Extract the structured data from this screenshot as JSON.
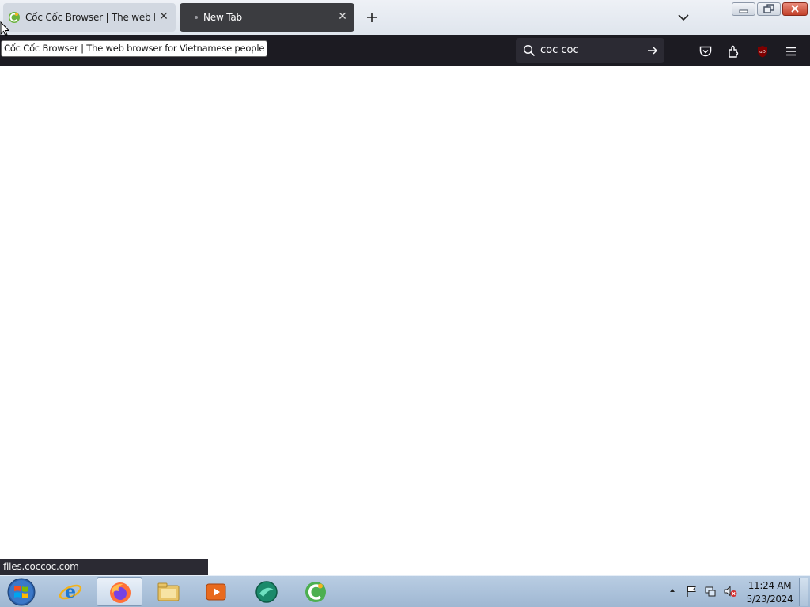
{
  "tabs": [
    {
      "title": "Cốc Cốc Browser | The web browser for Vietnamese people",
      "active": false,
      "favicon": "coccoc-icon"
    },
    {
      "title": "New Tab",
      "active": true,
      "favicon": "dot-icon"
    }
  ],
  "tooltip": "Cốc Cốc Browser | The web browser for Vietnamese people",
  "search": {
    "value": "coc coc"
  },
  "status_url": "files.coccoc.com",
  "clock": {
    "time": "11:24 AM",
    "date": "5/23/2024"
  },
  "taskbar": {
    "apps": [
      "internet-explorer-icon",
      "firefox-icon",
      "windows-explorer-icon",
      "media-player-icon",
      "app-icon",
      "coccoc-icon"
    ],
    "active": "firefox-icon"
  },
  "colors": {
    "navbar": "#1c1b22",
    "active_tab": "#3b3c40",
    "inactive_tab": "#d2d8e1",
    "status_bubble": "#2b2a33",
    "close_button": "#c3422b"
  }
}
